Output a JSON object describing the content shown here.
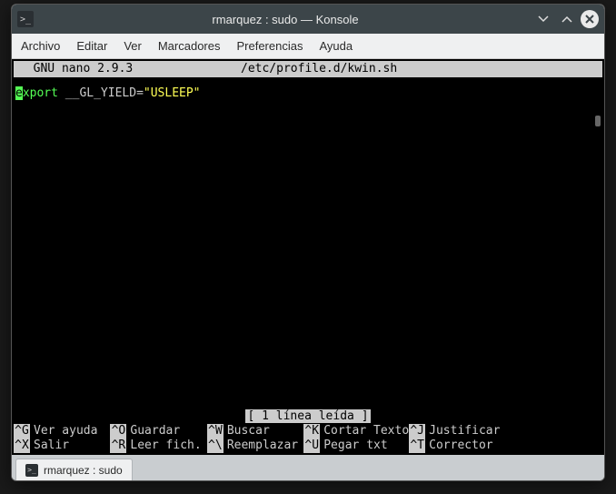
{
  "window": {
    "title": "rmarquez : sudo — Konsole"
  },
  "menubar": {
    "archivo": "Archivo",
    "editar": "Editar",
    "ver": "Ver",
    "marcadores": "Marcadores",
    "preferencias": "Preferencias",
    "ayuda": "Ayuda"
  },
  "nano": {
    "app": "  GNU nano 2.9.3",
    "file": "/etc/profile.d/kwin.sh",
    "cursor_char": "e",
    "line_kw": "xport ",
    "line_var": "__GL_YIELD=",
    "line_str": "\"USLEEP\"",
    "status": "[ 1 línea leída ]"
  },
  "shortcuts": {
    "g": {
      "key": "^G",
      "label": "Ver ayuda"
    },
    "o": {
      "key": "^O",
      "label": "Guardar"
    },
    "w": {
      "key": "^W",
      "label": "Buscar"
    },
    "k": {
      "key": "^K",
      "label": "Cortar Texto"
    },
    "j": {
      "key": "^J",
      "label": "Justificar"
    },
    "x": {
      "key": "^X",
      "label": "Salir"
    },
    "r": {
      "key": "^R",
      "label": "Leer fich."
    },
    "bs": {
      "key": "^\\",
      "label": "Reemplazar"
    },
    "u": {
      "key": "^U",
      "label": "Pegar txt"
    },
    "t": {
      "key": "^T",
      "label": "Corrector"
    }
  },
  "tab": {
    "label": "rmarquez : sudo"
  }
}
